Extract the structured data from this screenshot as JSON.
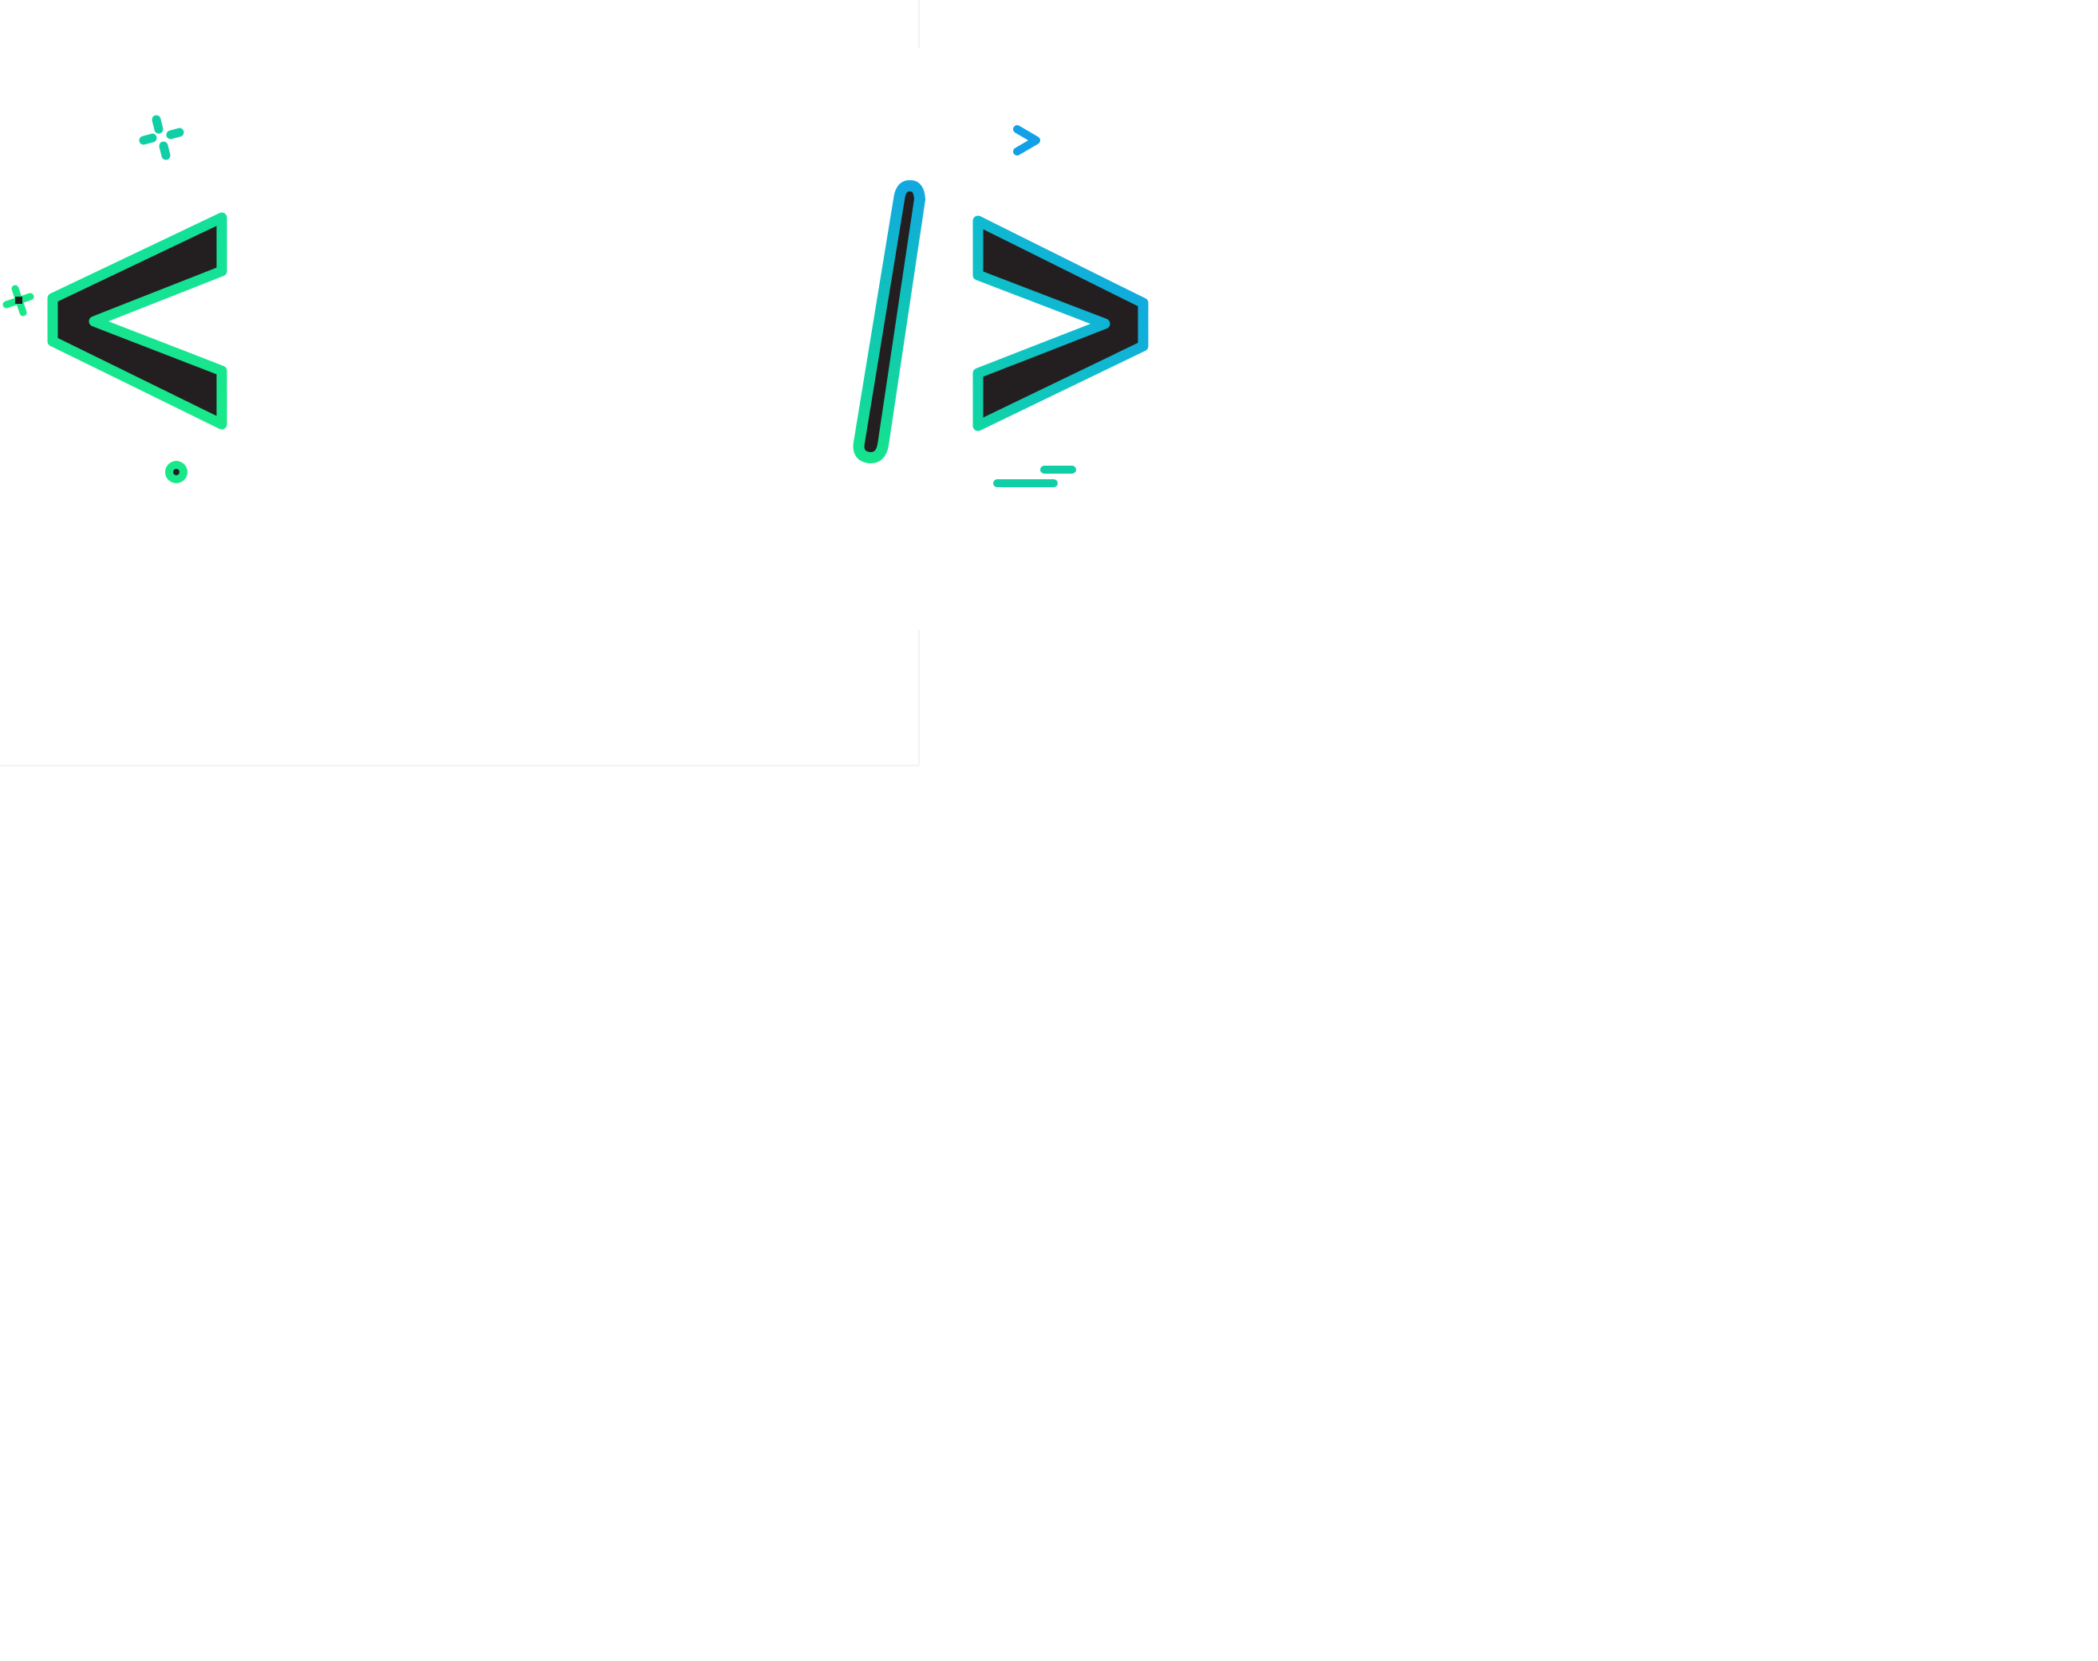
{
  "logo": {
    "symbol": "</>",
    "colors": {
      "green": "#19e88a",
      "teal": "#10cfa6",
      "cyan": "#0fb6cf",
      "blue": "#12a1e6",
      "fill": "#231f20",
      "background": "#ffffff",
      "guide": "#f3f3f3"
    },
    "icons": [
      "less-than-bracket-icon",
      "slash-icon",
      "greater-than-bracket-icon",
      "sparkle-icon",
      "cross-icon",
      "dot-icon",
      "small-chevron-icon",
      "dash-lines-icon"
    ]
  }
}
